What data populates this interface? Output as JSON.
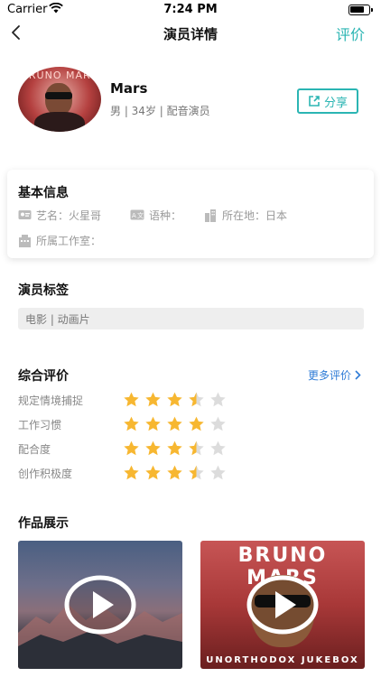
{
  "status_bar": {
    "carrier": "Carrier",
    "time": "7:24 PM"
  },
  "nav": {
    "title": "演员详情",
    "rate_label": "评价"
  },
  "actor": {
    "avatar_text": "BRUNO MARS",
    "name": "Mars",
    "meta": "男 | 34岁 | 配音演员",
    "share_label": "分享"
  },
  "basic_info": {
    "title": "基本信息",
    "stage_name": "艺名：火星哥",
    "language": "语种：",
    "location": "所在地：日本",
    "studio": "所属工作室："
  },
  "tags": {
    "title": "演员标签",
    "value": "电影 | 动画片"
  },
  "ratings": {
    "title": "综合评价",
    "more_label": "更多评价",
    "star_color": "#f7b731",
    "empty_star_color": "#dcdcdc",
    "items": [
      {
        "label": "规定情境捕捉",
        "stars": 3.5
      },
      {
        "label": "工作习惯",
        "stars": 4
      },
      {
        "label": "配合度",
        "stars": 3.5
      },
      {
        "label": "创作积极度",
        "stars": 3.5
      }
    ]
  },
  "works": {
    "title": "作品展示",
    "items": [
      {
        "cover": "mountain-landscape"
      },
      {
        "cover": "album",
        "cover_title": "BRUNO MARS",
        "cover_sub": "UNORTHODOX JUKEBOX"
      }
    ]
  },
  "colors": {
    "accent": "#2bb5b3",
    "link": "#2e7bd6"
  }
}
